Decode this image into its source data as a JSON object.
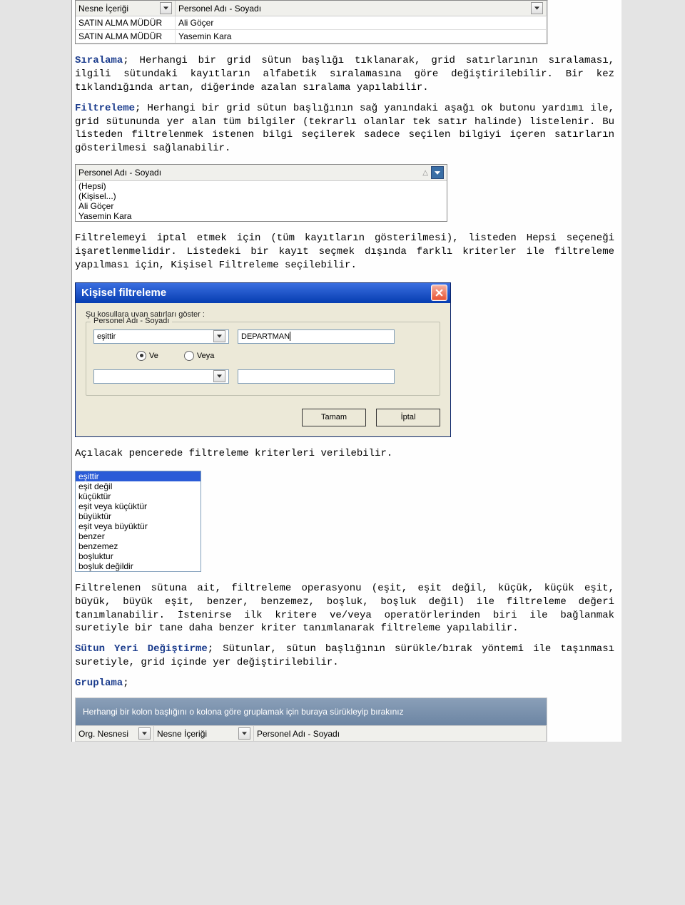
{
  "grid1": {
    "headers": [
      "Nesne İçeriği",
      "Personel Adı - Soyadı"
    ],
    "rows": [
      [
        "SATIN ALMA MÜDÜR",
        "Ali Göçer"
      ],
      [
        "SATIN ALMA MÜDÜR",
        "Yasemin Kara"
      ]
    ]
  },
  "para_sort_term": "Sıralama",
  "para_sort": "; Herhangi bir grid sütun başlığı tıklanarak, grid satırlarının sıralaması, ilgili sütundaki kayıtların alfabetik sıralamasına göre değiştirilebilir. Bir kez tıklandığında artan, diğerinde azalan sıralama yapılabilir.",
  "para_filter_term": "Filtreleme",
  "para_filter": "; Herhangi bir grid sütun başlığının sağ yanındaki aşağı ok butonu yardımı ile, grid sütununda yer alan tüm bilgiler (tekrarlı olanlar tek satır halinde) listelenir. Bu listeden filtrelenmek istenen bilgi seçilerek sadece seçilen bilgiyi içeren satırların gösterilmesi sağlanabilir.",
  "filter_col": {
    "header": "Personel Adı - Soyadı",
    "options": [
      "(Hepsi)",
      "(Kişisel...)",
      "Ali Göçer",
      "Yasemin Kara"
    ]
  },
  "para_filter2": "Filtrelemeyi iptal etmek için (tüm kayıtların gösterilmesi), listeden Hepsi seçeneği işaretlenmelidir. Listedeki bir kayıt seçmek dışında farklı kriterler ile filtreleme yapılması için, Kişisel Filtreleme seçilebilir.",
  "dialog": {
    "title": "Kişisel filtreleme",
    "prompt": "Şu koşullara uyan satırları göster :",
    "legend": "Personel Adı - Soyadı",
    "op1": "eşittir",
    "val1": "DEPARTMAN",
    "radio_and": "Ve",
    "radio_or": "Veya",
    "op2": "",
    "val2": "",
    "ok": "Tamam",
    "cancel": "İptal"
  },
  "para_open": "Açılacak pencerede filtreleme kriterleri verilebilir.",
  "operators": [
    "eşittir",
    "eşit değil",
    "küçüktür",
    "eşit veya küçüktür",
    "büyüktür",
    "eşit veya büyüktür",
    "benzer",
    "benzemez",
    "boşluktur",
    "boşluk değildir"
  ],
  "para_ops": "Filtrelenen sütuna ait, filtreleme operasyonu (eşit, eşit değil, küçük, küçük eşit, büyük, büyük eşit, benzer, benzemez, boşluk, boşluk değil) ile filtreleme değeri tanımlanabilir. İstenirse ilk kritere ve/veya operatörlerinden biri ile bağlanmak suretiyle bir tane daha benzer kriter tanımlanarak filtreleme yapılabilir.",
  "para_move_term": "Sütun Yeri Değiştirme",
  "para_move": "; Sütunlar, sütun başlığının sürükle/bırak yöntemi ile taşınması suretiyle, grid içinde yer değiştirilebilir.",
  "para_group_term": "Gruplama",
  "para_group": ";",
  "grouppanel": {
    "hint": "Herhangi bir kolon başlığını o kolona göre gruplamak için buraya sürükleyip bırakınız",
    "headers": [
      "Org. Nesnesi",
      "Nesne İçeriği",
      "Personel Adı - Soyadı"
    ]
  }
}
